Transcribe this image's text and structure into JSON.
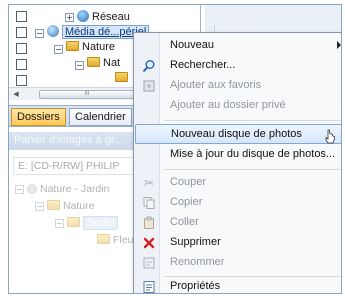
{
  "tree": {
    "nodes": [
      {
        "label": "Réseau"
      },
      {
        "label": "Média dé...périel"
      },
      {
        "label": "Nature"
      },
      {
        "label": "Nat"
      }
    ],
    "scroll_thumb_label": "III"
  },
  "tabs": [
    {
      "label": "Dossiers",
      "active": true
    },
    {
      "label": "Calendrier",
      "active": false
    }
  ],
  "lower": {
    "panel_title": "Panier d'images à gr...",
    "device_value": "E: [CD-R/RW] PHILIP",
    "nodes": [
      {
        "label": "Nature - Jardin"
      },
      {
        "label": "Nature"
      },
      {
        "label": "Jardin"
      },
      {
        "label": "Fleu"
      }
    ]
  },
  "context_menu": {
    "items": [
      {
        "label": "Nouveau",
        "icon": "none",
        "has_submenu": true,
        "enabled": true
      },
      {
        "label": "Rechercher...",
        "icon": "search-icon",
        "enabled": true
      },
      {
        "label": "Ajouter aux favoris",
        "icon": "add-favorites-icon",
        "enabled": false
      },
      {
        "label": "Ajouter au dossier privé",
        "icon": "none",
        "enabled": false
      },
      {
        "label": "Nouveau disque de photos",
        "icon": "none",
        "enabled": true,
        "hovered": true
      },
      {
        "label": "Mise à jour du disque de photos...",
        "icon": "none",
        "enabled": true
      },
      {
        "label": "Couper",
        "icon": "scissors-icon",
        "enabled": false
      },
      {
        "label": "Copier",
        "icon": "copy-icon",
        "enabled": false
      },
      {
        "label": "Coller",
        "icon": "paste-icon",
        "enabled": false
      },
      {
        "label": "Supprimer",
        "icon": "delete-x-icon",
        "enabled": true
      },
      {
        "label": "Renommer",
        "icon": "rename-icon",
        "enabled": false
      },
      {
        "label": "Propriétés",
        "icon": "properties-icon",
        "enabled": true
      }
    ]
  },
  "colors": {
    "hover_bg": "#d6e7fb",
    "active_tab": "#ffc65a",
    "delete_icon": "#d42020",
    "disabled_text": "#8f959d"
  }
}
